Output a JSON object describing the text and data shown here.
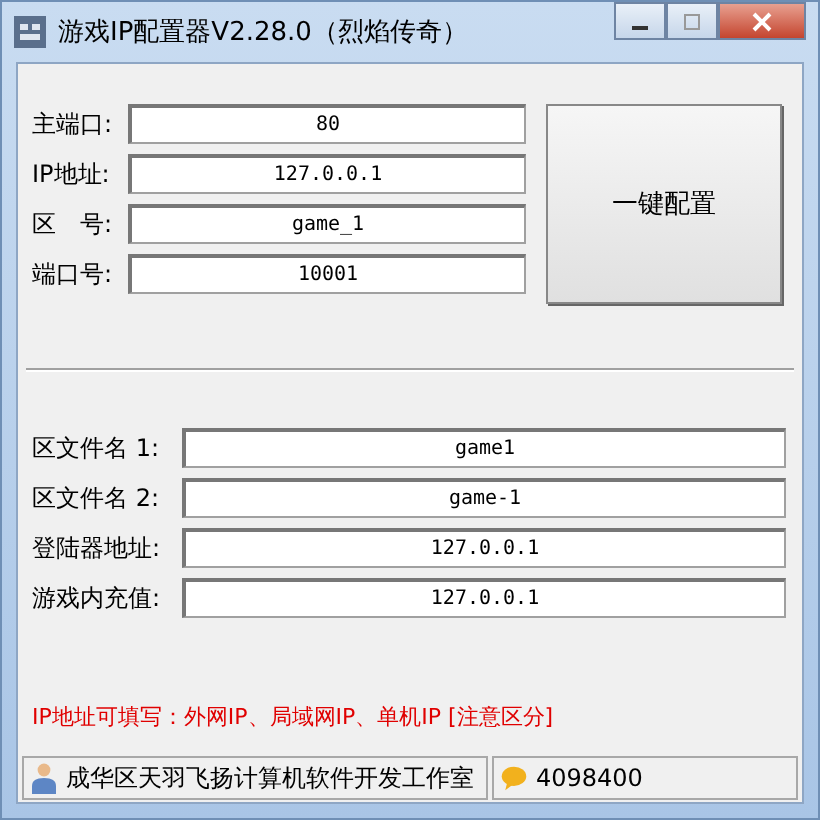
{
  "window": {
    "title": "游戏IP配置器V2.28.0（烈焰传奇）"
  },
  "top_fields": [
    {
      "label": "主端口:",
      "value": "80"
    },
    {
      "label": "IP地址:",
      "value": "127.0.0.1"
    },
    {
      "label": "区　号:",
      "value": "game_1"
    },
    {
      "label": "端口号:",
      "value": "10001"
    }
  ],
  "config_button": "一键配置",
  "bottom_fields": [
    {
      "label": "区文件名 1:",
      "value": "game1"
    },
    {
      "label": "区文件名 2:",
      "value": "game-1"
    },
    {
      "label": "登陆器地址:",
      "value": "127.0.0.1"
    },
    {
      "label": "游戏内充值:",
      "value": "127.0.0.1"
    }
  ],
  "note": "IP地址可填写：外网IP、局域网IP、单机IP [注意区分]",
  "status_bar": {
    "studio": "成华区天羽飞扬计算机软件开发工作室",
    "contact": "4098400"
  }
}
